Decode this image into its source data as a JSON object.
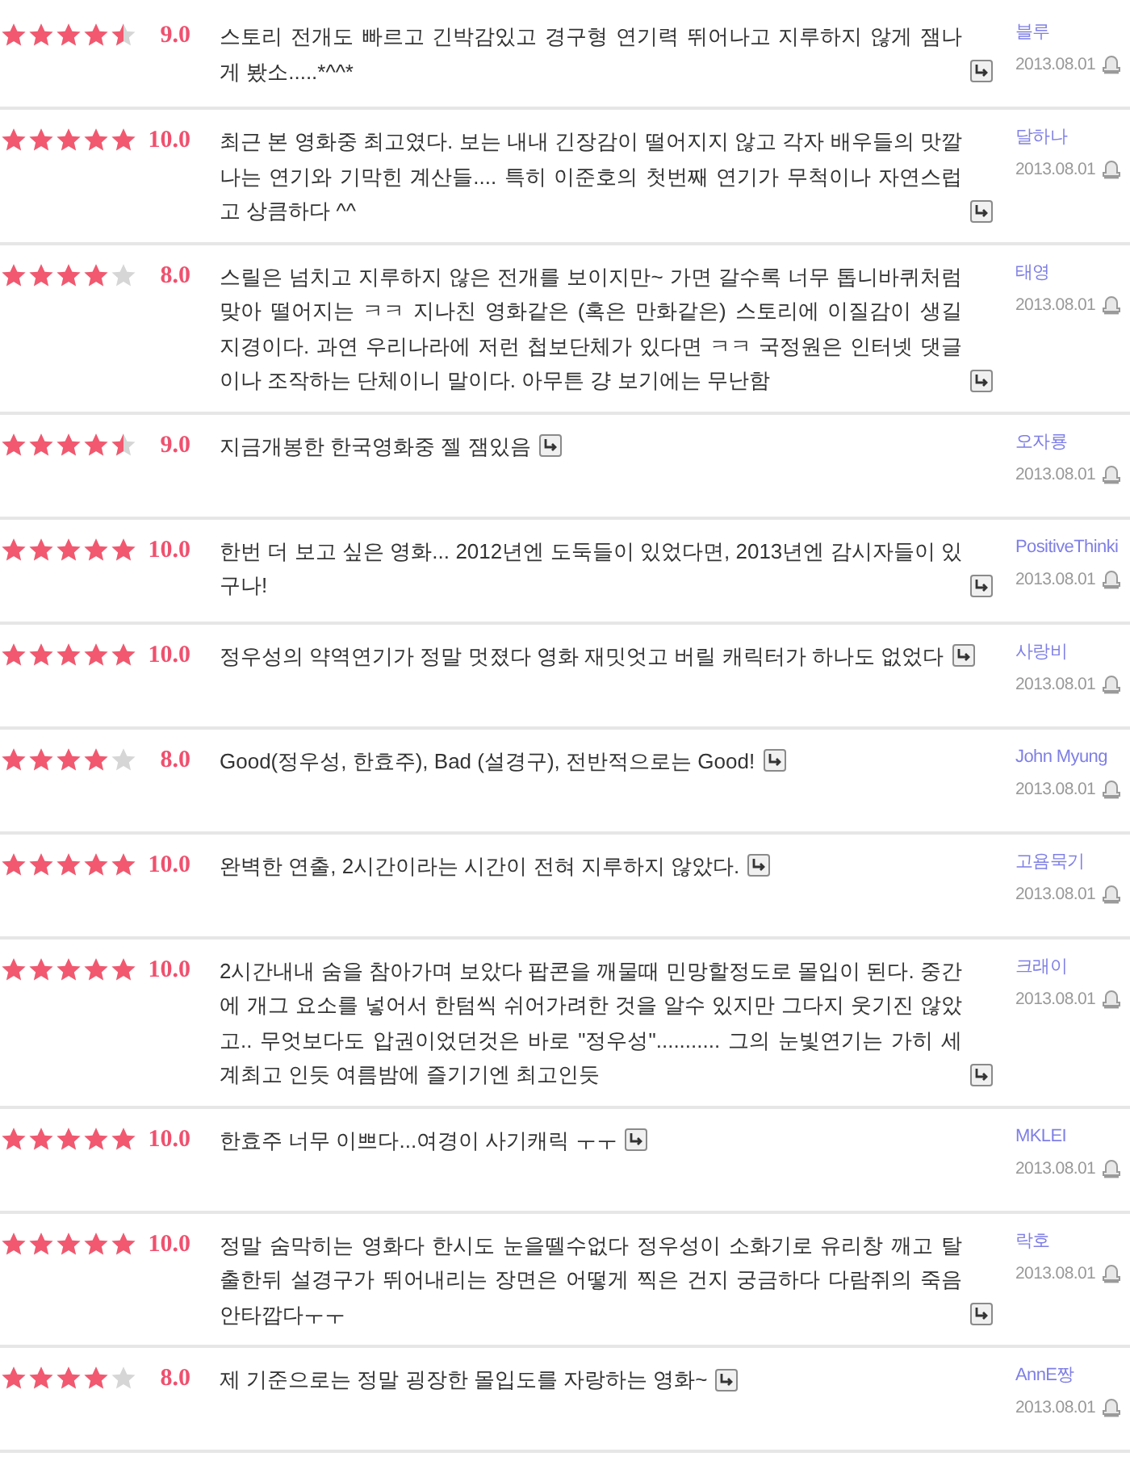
{
  "reviews": [
    {
      "stars": 4.5,
      "score": "9.0",
      "comment": "스토리 전개도 빠르고 긴박감있고 경구형 연기력 뛰어나고 지루하지 않게 잼나게 봤소.....*^^*",
      "user": "블루",
      "date": "2013.08.01"
    },
    {
      "stars": 5,
      "score": "10.0",
      "comment": "최근 본 영화중 최고였다. 보는 내내 긴장감이 떨어지지 않고 각자 배우들의 맛깔나는 연기와 기막힌 계산들.... 특히 이준호의 첫번째 연기가 무척이나 자연스럽고 상큼하다 ^^",
      "user": "달하나",
      "date": "2013.08.01"
    },
    {
      "stars": 4,
      "score": "8.0",
      "comment": "스릴은 넘치고 지루하지 않은 전개를 보이지만~ 가면 갈수록 너무 톱니바퀴처럼 맞아 떨어지는 ㅋㅋ 지나친 영화같은 (혹은 만화같은) 스토리에 이질감이 생길 지경이다. 과연 우리나라에 저런 첩보단체가 있다면 ㅋㅋ 국정원은 인터넷 댓글이나 조작하는 단체이니 말이다. 아무튼 걍 보기에는 무난함",
      "user": "태영",
      "date": "2013.08.01"
    },
    {
      "stars": 4.5,
      "score": "9.0",
      "comment": "지금개봉한 한국영화중 젤 잼있음",
      "user": "오자룡",
      "date": "2013.08.01"
    },
    {
      "stars": 5,
      "score": "10.0",
      "comment": "한번 더 보고 싶은 영화... 2012년엔 도둑들이 있었다면, 2013년엔 감시자들이 있구나!",
      "user": "PositiveThinki",
      "date": "2013.08.01"
    },
    {
      "stars": 5,
      "score": "10.0",
      "comment": "정우성의 약역연기가 정말 멋졌다 영화 재밋엇고 버릴 캐릭터가 하나도 없었다",
      "user": "사랑비",
      "date": "2013.08.01"
    },
    {
      "stars": 4,
      "score": "8.0",
      "comment": "Good(정우성, 한효주), Bad (설경구), 전반적으로는 Good!",
      "user": "John Myung",
      "date": "2013.08.01"
    },
    {
      "stars": 5,
      "score": "10.0",
      "comment": "완벽한 연출, 2시간이라는 시간이 전혀 지루하지 않았다.",
      "user": "고욤묵기",
      "date": "2013.08.01"
    },
    {
      "stars": 5,
      "score": "10.0",
      "comment": "2시간내내 숨을 참아가며 보았다 팝콘을 깨물때 민망할정도로 몰입이 된다. 중간에 개그 요소를 넣어서 한텀씩 쉬어가려한 것을 알수 있지만 그다지 웃기진 않았고.. 무엇보다도 압권이었던것은 바로 \"정우성\"........... 그의 눈빛연기는 가히 세계최고 인듯 여름밤에 즐기기엔 최고인듯",
      "user": "크래이",
      "date": "2013.08.01"
    },
    {
      "stars": 5,
      "score": "10.0",
      "comment": "한효주 너무 이쁘다...여경이 사기캐릭 ㅜㅜ",
      "user": "MKLEI",
      "date": "2013.08.01"
    },
    {
      "stars": 5,
      "score": "10.0",
      "comment": "정말 숨막히는 영화다 한시도 눈을뗄수없다 정우성이 소화기로 유리창 깨고 탈출한뒤 설경구가 뛰어내리는 장면은 어떻게 찍은 건지 궁금하다 다람쥐의 죽음 안타깝다ㅜㅜ",
      "user": "락호",
      "date": "2013.08.01"
    },
    {
      "stars": 4,
      "score": "8.0",
      "comment": "제 기준으로는 정말 굉장한 몰입도를 자랑하는 영화~",
      "user": "AnnE짱",
      "date": "2013.08.01"
    }
  ]
}
